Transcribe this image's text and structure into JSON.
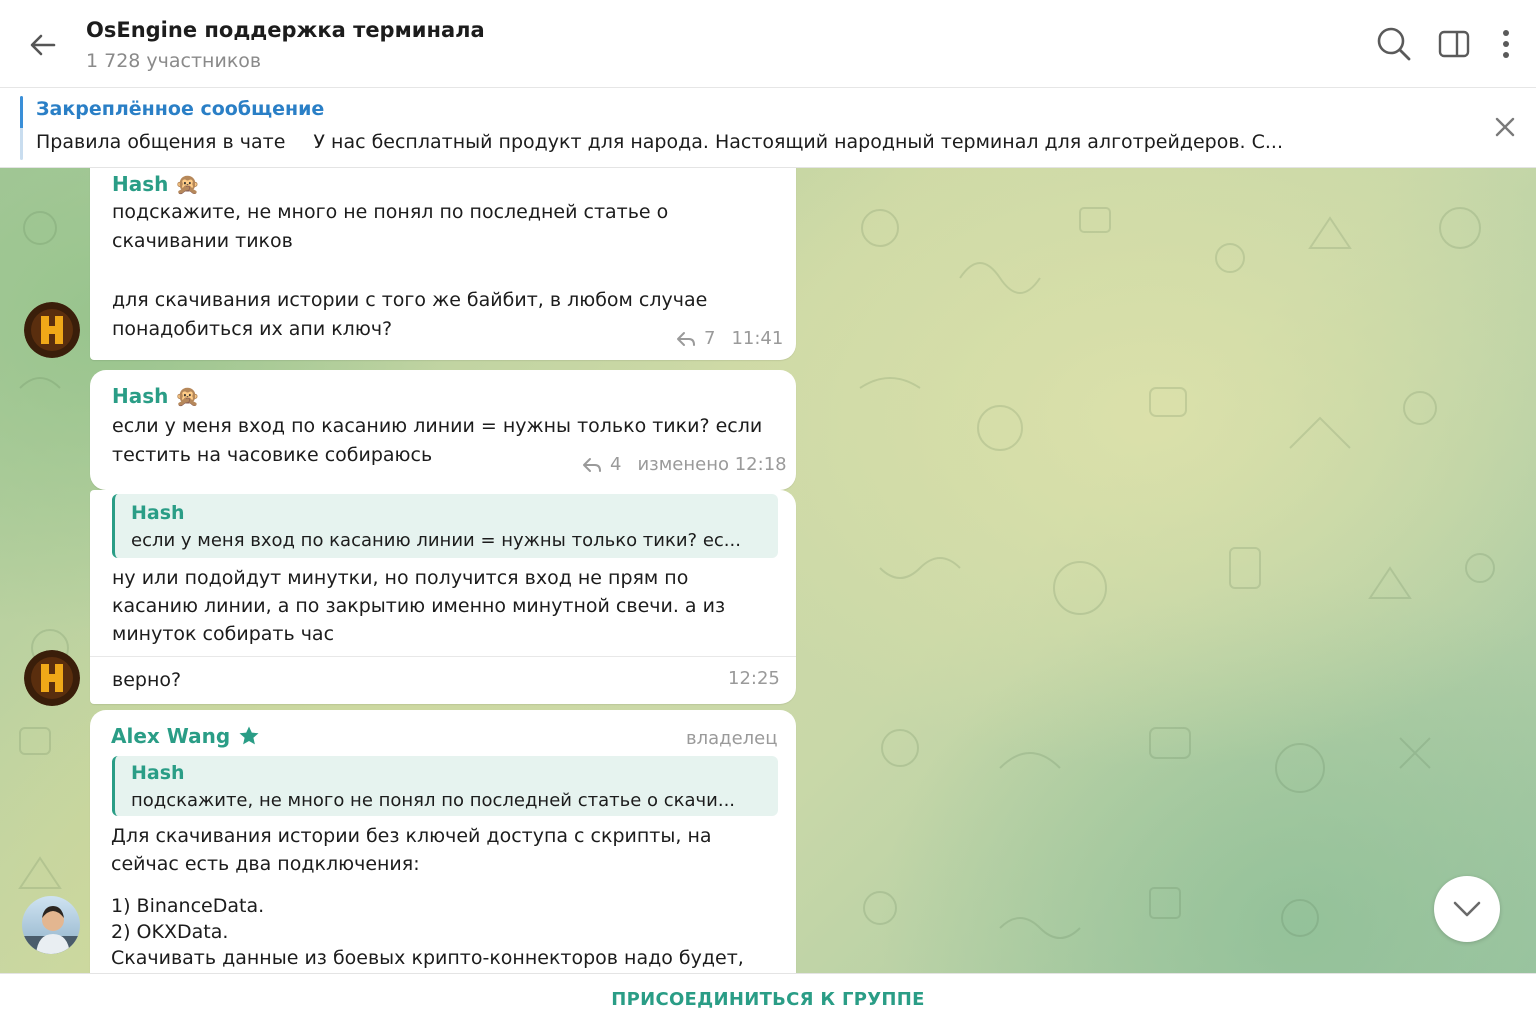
{
  "header": {
    "title": "OsEngine поддержка терминала",
    "subtitle": "1 728 участников"
  },
  "pinned": {
    "label": "Закреплённое сообщение",
    "title": "Правила общения в чате",
    "preview": "У нас бесплатный продукт для народа. Настоящий народный терминал для алготрейдеров. С..."
  },
  "messages": [
    {
      "author": "Hash",
      "emoji": "🙊",
      "text1": "подскажите, не много не понял по последней статье о скачивании тиков",
      "text2": "для скачивания истории с того же байбит, в любом случае понадобиться их апи ключ?",
      "replies": "7",
      "time": "11:41"
    },
    {
      "author": "Hash",
      "emoji": "🙊",
      "text": "если у меня вход по касанию линии = нужны только тики? если тестить на часовике собираюсь",
      "replies": "4",
      "edited_time": "изменено 12:18"
    },
    {
      "quote_name": "Hash",
      "quote_text": "если у меня вход по касанию линии = нужны только тики? ес...",
      "text": "ну или подойдут минутки, но получится вход не прям по касанию линии, а по закрытию именно минутной свечи. а из минуток собирать час"
    },
    {
      "text": "верно?",
      "time": "12:25"
    },
    {
      "author": "Alex Wang",
      "role": "владелец",
      "quote_name": "Hash",
      "quote_text": "подскажите, не много не понял по последней статье о скачи...",
      "text1": "Для скачивания истории без ключей доступа с скрипты, на сейчас есть два подключения:",
      "line1": "1) BinanceData.",
      "line2": "2) OKXData.",
      "line3": "Скачивать данные из боевых крипто-коннекторов надо будет,"
    }
  ],
  "bottom": {
    "join_label": "ПРИСОЕДИНИТЬСЯ К ГРУППЕ"
  },
  "colors": {
    "accent": "#2a9d86",
    "pinned_accent": "#2a7fc6",
    "avatar_hash_bg": "#3a1e0a",
    "avatar_hash_glyph": "#f0a818"
  },
  "icons": {
    "back": "arrow-left-icon",
    "search": "search-icon",
    "sidebar": "sidebar-toggle-icon",
    "more": "more-vertical-icon",
    "close": "close-icon",
    "reply": "reply-arrow-icon",
    "star": "star-icon",
    "scroll": "chevron-down-icon"
  }
}
